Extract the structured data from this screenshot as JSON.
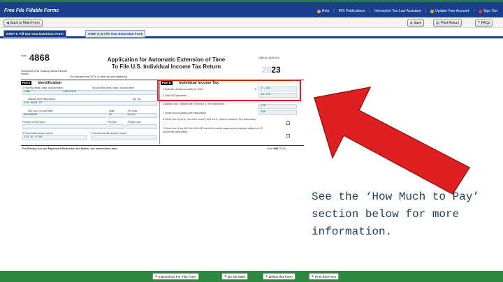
{
  "app": {
    "brand": "Free File Fillable Forms"
  },
  "top_links": [
    "Help",
    "IRS Publications",
    "Interactive Tax Law Assistant",
    "Update Your Account",
    "Sign Out"
  ],
  "toolbar": {
    "back": "Back to Main Form",
    "save": "Save",
    "print_return": "Print Return",
    "faqs": "FAQs"
  },
  "tabs": [
    "STEP 1: Fill Out Your Extension Form",
    "STEP 2: E-File Your Extension Form"
  ],
  "form": {
    "form_label": "Form",
    "form_number": "4868",
    "department": "Department of the Treasury Internal Revenue Service",
    "title_line1": "Application for Automatic Extension of Time",
    "title_line2": "To File U.S. Individual Income Tax Return",
    "subtitle": "For calendar year 2023, or other tax year beginning",
    "omb": "OMB No. 1545-0074",
    "year_prefix": "20",
    "year_suffix": "23",
    "part1_label": "Part I",
    "part1_title": "Identification",
    "part2_label": "Part II",
    "part2_title": "Individual Income Tax",
    "l1_label": "1  Your first name, initial, and last name",
    "spouse_label": "Spouse first name, initial, and last name",
    "first_name": "JANE",
    "last_name": "TAXPAYER",
    "address_label": "Address (see instructions)",
    "apt_label": "Apt. No.",
    "address": "123 MAIN ST",
    "city_label": "City, town, or post office",
    "state_label": "State",
    "zip_label": "ZIP code",
    "city": "ANYWHERE",
    "state": "DL",
    "zip": "12131",
    "foreign_country_label": "Foreign country name",
    "province_label": "Province",
    "postal_label": "Postal Code",
    "ssn_label": "2  Your social security number",
    "spouse_ssn_label": "3  Spouse's social security number",
    "ssn": "123-45-6789",
    "l4_label": "4  Estimate of total tax liability for 2023.",
    "l4_dollar": "$",
    "l4_value": "17,445",
    "l5_label": "5  Total 2023 payments",
    "l5_value": "16,750",
    "l6_label": "6  Balance due. Subtract line 5 from line 4. See instructions",
    "l6_value": "700",
    "l7_label": "7  Amount you're paying (see instructions)",
    "l7_value": "300",
    "l8_label": "8  Check here if you're \"out of the country\" and a U.S. citizen or resident. See instructions",
    "l9_label": "9  Check here if you file Form 1040-NR and didn't receive wages as an employee subject to U.S. income tax withholding",
    "footer_left": "For Privacy Act and Paperwork Reduction Act Notice, see instructions later.",
    "footer_right_prefix": "Form",
    "footer_right_num": "4868",
    "footer_right_year": "(2023)"
  },
  "caption": "See the ‘How Much to Pay’ section below for more information.",
  "bottom_buttons": [
    "Instructions For This Form",
    "Do the Math",
    "Delete this Form",
    "Print this Form"
  ],
  "colors": {
    "header_blue": "#1b3f8f",
    "accent_green": "#2b8a3e",
    "arrow_red": "#e02020",
    "caption_text": "#1d3e5d"
  }
}
